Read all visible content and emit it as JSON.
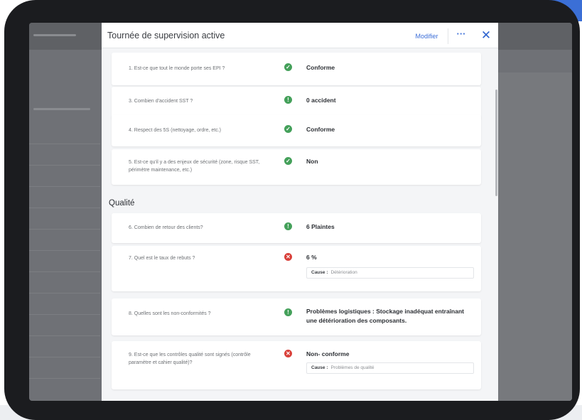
{
  "modal": {
    "title": "Tournée de supervision active",
    "edit_label": "Modifier",
    "more_label": "···",
    "close_label": "✕"
  },
  "section_quality": "Qualité",
  "questions": [
    {
      "num": "1.",
      "text": "Est-ce que tout le monde porte ses EPI ?",
      "status": "check",
      "answer": "Conforme"
    },
    {
      "num": "3.",
      "text": "Combien d'accident SST ?",
      "status": "info",
      "answer": "0 accident"
    },
    {
      "num": "4.",
      "text": "Respect des 5S (nettoyage, ordre, etc.)",
      "status": "check",
      "answer": "Conforme"
    },
    {
      "num": "5.",
      "text": "Est-ce qu'il y a des enjeux de sécurité (zone, risque SST, périmètre maintenance, etc.)",
      "status": "check",
      "answer": "Non"
    },
    {
      "num": "6.",
      "text": "Combien de retour des clients?",
      "status": "info",
      "answer": "6 Plaintes"
    },
    {
      "num": "7.",
      "text": "Quel est le taux de rebuts ?",
      "status": "cross",
      "answer": "6 %",
      "cause_label": "Cause :",
      "cause_value": "Détérioration"
    },
    {
      "num": "8.",
      "text": "Quelles sont les non-conformités ?",
      "status": "info",
      "answer": "Problèmes logistiques : Stockage inadéquat entraînant une détérioration des composants."
    },
    {
      "num": "9.",
      "text": "Est-ce que les contrôles qualité sont signés (contrôle paramètre et cahier qualité)?",
      "status": "cross",
      "answer": "Non- conforme",
      "cause_label": "Cause :",
      "cause_value": "Problèmes de qualité"
    }
  ],
  "icons": {
    "check": "✓",
    "info": "!",
    "cross": "✕"
  },
  "colors": {
    "accent": "#3d6fd8",
    "ok": "#44a05a",
    "bad": "#d9403a"
  }
}
